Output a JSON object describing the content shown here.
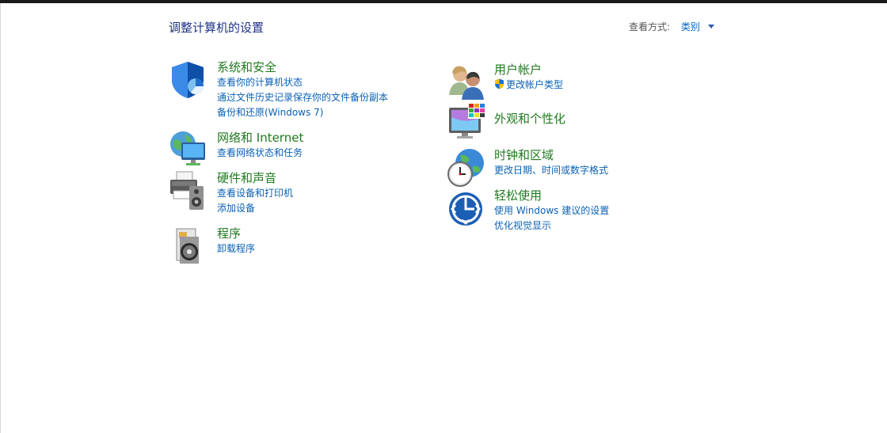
{
  "header": {
    "title": "调整计算机的设置",
    "view_by_label": "查看方式:",
    "view_by_value": "类别"
  },
  "categories": [
    {
      "icon": "security-shield-icon",
      "title": "系统和安全",
      "links": [
        "查看你的计算机状态",
        "通过文件历史记录保存你的文件备份副本",
        "备份和还原(Windows 7)"
      ]
    },
    {
      "icon": "network-globe-icon",
      "title": "网络和 Internet",
      "links": [
        "查看网络状态和任务"
      ]
    },
    {
      "icon": "printer-speaker-icon",
      "title": "硬件和声音",
      "links": [
        "查看设备和打印机",
        "添加设备"
      ]
    },
    {
      "icon": "programs-disc-icon",
      "title": "程序",
      "links": [
        "卸载程序"
      ]
    },
    {
      "icon": "users-icon",
      "title": "用户帐户",
      "links": [
        "更改帐户类型"
      ]
    },
    {
      "icon": "monitor-palette-icon",
      "title": "外观和个性化",
      "links": []
    },
    {
      "icon": "clock-globe-icon",
      "title": "时钟和区域",
      "links": [
        "更改日期、时间或数字格式"
      ]
    },
    {
      "icon": "ease-of-access-icon",
      "title": "轻松使用",
      "links": [
        "使用 Windows 建议的设置",
        "优化视觉显示"
      ]
    }
  ],
  "colors": {
    "title": "#1e3287",
    "category_title": "#1f7a1f",
    "link": "#0a61b6"
  }
}
